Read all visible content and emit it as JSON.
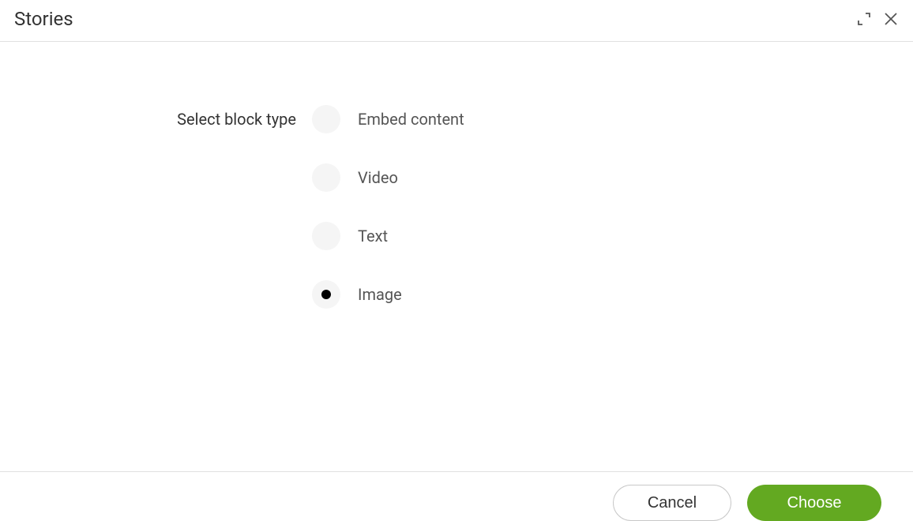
{
  "header": {
    "title": "Stories"
  },
  "form": {
    "label": "Select block type",
    "options": [
      {
        "label": "Embed content",
        "selected": false
      },
      {
        "label": "Video",
        "selected": false
      },
      {
        "label": "Text",
        "selected": false
      },
      {
        "label": "Image",
        "selected": true
      }
    ]
  },
  "footer": {
    "cancel_label": "Cancel",
    "choose_label": "Choose"
  }
}
